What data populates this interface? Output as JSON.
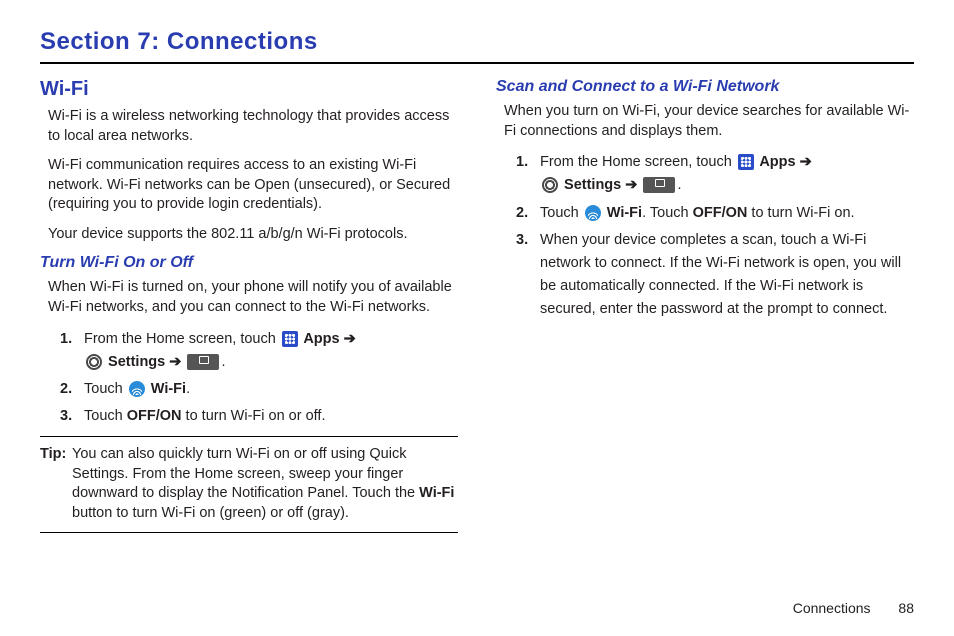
{
  "section_title": "Section 7: Connections",
  "footer": {
    "label": "Connections",
    "page": "88"
  },
  "left": {
    "h2": "Wi-Fi",
    "p1": "Wi-Fi is a wireless networking technology that provides access to local area networks.",
    "p2": "Wi-Fi communication requires access to an existing Wi-Fi network. Wi-Fi networks can be Open (unsecured), or Secured (requiring you to provide login credentials).",
    "p3": "Your device supports the 802.11 a/b/g/n Wi-Fi protocols.",
    "h3": "Turn Wi-Fi On or Off",
    "p4": "When Wi-Fi is turned on, your phone will notify you of available Wi-Fi networks, and you can connect to the Wi-Fi networks.",
    "step1_a": "From the Home screen, touch ",
    "apps_label": " Apps ",
    "arrow": "➔",
    "settings_label": " Settings ",
    "step2_a": "Touch ",
    "wifi_label": " Wi-Fi",
    "step3": "Touch ",
    "offon": "OFF/ON",
    "step3_b": " to turn Wi-Fi on or off.",
    "tip_label": "Tip:",
    "tip_body_a": " You can also quickly turn Wi-Fi on or off using Quick Settings. From the Home screen, sweep your finger downward to display the Notification Panel. Touch the ",
    "tip_wifi": "Wi-Fi",
    "tip_body_b": " button to turn Wi-Fi on (green) or off (gray)."
  },
  "right": {
    "h3": "Scan and Connect to a Wi-Fi Network",
    "p1": "When you turn on Wi-Fi, your device searches for available Wi-Fi connections and displays them.",
    "step1_a": "From the Home screen, touch ",
    "apps_label": " Apps ",
    "arrow": "➔",
    "settings_label": " Settings ",
    "step2_a": "Touch ",
    "wifi_label": " Wi-Fi",
    "step2_b": ". Touch ",
    "offon": "OFF/ON",
    "step2_c": " to turn Wi-Fi on.",
    "step3": "When your device completes a scan, touch a Wi-Fi network to connect. If the Wi-Fi network is open, you will be automatically connected. If the Wi-Fi network is secured, enter the password at the prompt to connect."
  }
}
